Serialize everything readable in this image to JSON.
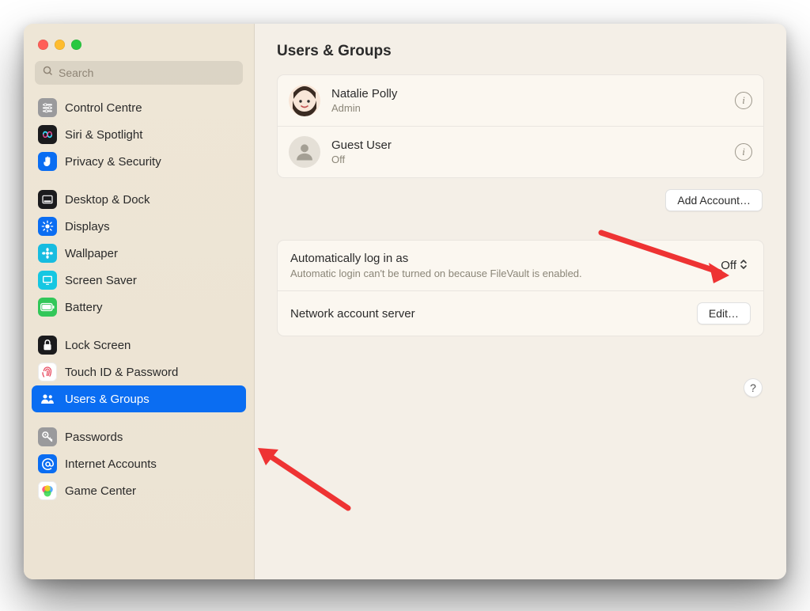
{
  "sidebar": {
    "search_placeholder": "Search",
    "groups": [
      {
        "items": [
          {
            "key": "control-centre",
            "label": "Control Centre",
            "icon": "sliders",
            "bg": "#9a9a9c"
          },
          {
            "key": "siri-spotlight",
            "label": "Siri & Spotlight",
            "icon": "siri",
            "bg": "#1b1b1d"
          },
          {
            "key": "privacy-security",
            "label": "Privacy & Security",
            "icon": "hand",
            "bg": "#0a6df2"
          }
        ]
      },
      {
        "items": [
          {
            "key": "desktop-dock",
            "label": "Desktop & Dock",
            "icon": "dock",
            "bg": "#1b1b1d"
          },
          {
            "key": "displays",
            "label": "Displays",
            "icon": "sun",
            "bg": "#0a6df2"
          },
          {
            "key": "wallpaper",
            "label": "Wallpaper",
            "icon": "flower",
            "bg": "#17bce0"
          },
          {
            "key": "screen-saver",
            "label": "Screen Saver",
            "icon": "screensaver",
            "bg": "#15c7e2"
          },
          {
            "key": "battery",
            "label": "Battery",
            "icon": "battery",
            "bg": "#32c759"
          }
        ]
      },
      {
        "items": [
          {
            "key": "lock-screen",
            "label": "Lock Screen",
            "icon": "lock",
            "bg": "#1b1b1d"
          },
          {
            "key": "touch-id",
            "label": "Touch ID & Password",
            "icon": "fingerprint",
            "bg": "#fff",
            "fg": "#e84a5f"
          },
          {
            "key": "users-groups",
            "label": "Users & Groups",
            "icon": "people",
            "bg": "#0a6df2",
            "selected": true
          }
        ]
      },
      {
        "items": [
          {
            "key": "passwords",
            "label": "Passwords",
            "icon": "key",
            "bg": "#9a9a9c"
          },
          {
            "key": "internet-accounts",
            "label": "Internet Accounts",
            "icon": "at",
            "bg": "#0a6df2"
          },
          {
            "key": "game-center",
            "label": "Game Center",
            "icon": "gamecenter",
            "bg": "#fff"
          }
        ]
      }
    ]
  },
  "main": {
    "title": "Users & Groups",
    "users": [
      {
        "name": "Natalie Polly",
        "role": "Admin",
        "avatar": "memoji"
      },
      {
        "name": "Guest User",
        "role": "Off",
        "avatar": "guest"
      }
    ],
    "add_account_label": "Add Account…",
    "auto_login": {
      "title": "Automatically log in as",
      "subtitle": "Automatic login can't be turned on because FileVault is enabled.",
      "value": "Off"
    },
    "network_server": {
      "title": "Network account server",
      "button": "Edit…"
    },
    "help_label": "?"
  }
}
